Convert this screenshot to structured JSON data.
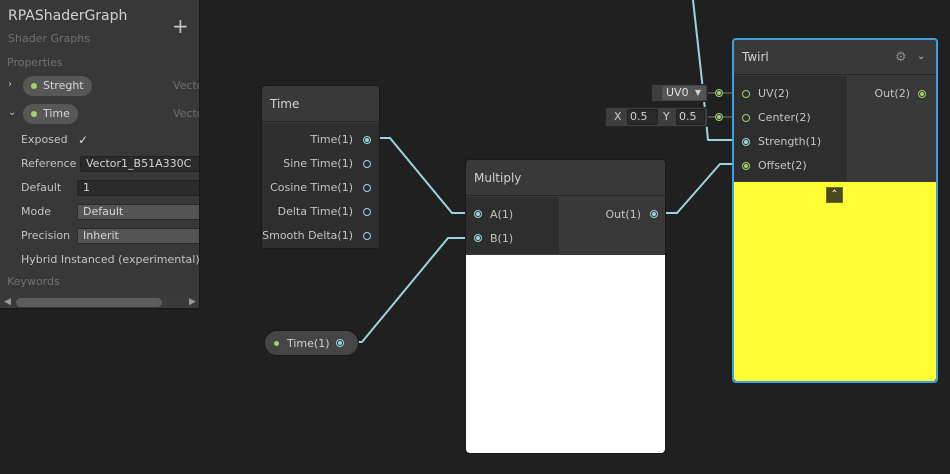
{
  "blackboard": {
    "title": "RPAShaderGraph",
    "subtitle": "Shader Graphs",
    "add_icon": "+",
    "properties_header": "Properties",
    "keywords_header": "Keywords",
    "properties": [
      {
        "name": "Streght",
        "type": "Vecto",
        "expanded": false
      },
      {
        "name": "Time",
        "type": "Vecto",
        "expanded": true
      }
    ],
    "fields": {
      "exposed_label": "Exposed",
      "exposed_check": "✓",
      "reference_label": "Reference",
      "reference_value": "Vector1_B51A330C",
      "default_label": "Default",
      "default_value": "1",
      "mode_label": "Mode",
      "mode_value": "Default",
      "precision_label": "Precision",
      "precision_value": "Inherit",
      "hybrid_label": "Hybrid Instanced (experimental)"
    }
  },
  "nodes": {
    "time": {
      "title": "Time",
      "outputs": [
        "Time(1)",
        "Sine Time(1)",
        "Cosine Time(1)",
        "Delta Time(1)",
        "Smooth Delta(1)"
      ]
    },
    "multiply": {
      "title": "Multiply",
      "inputs": [
        "A(1)",
        "B(1)"
      ],
      "outputs": [
        "Out(1)"
      ],
      "preview_color": "#ffffff"
    },
    "twirl": {
      "title": "Twirl",
      "inputs": [
        "UV(2)",
        "Center(2)",
        "Strength(1)",
        "Offset(2)"
      ],
      "outputs": [
        "Out(2)"
      ],
      "preview_color": "#ffff33",
      "selection_color": "#3f9fe0"
    },
    "time_property": {
      "label": "Time(1)"
    }
  },
  "inline_inputs": {
    "uv_channel": "UV0",
    "center_x_label": "X",
    "center_x": "0.5",
    "center_y_label": "Y",
    "center_y": "0.5"
  },
  "colors": {
    "wire": "#9ad4e0",
    "float_port": "#9ad4e0",
    "vector2_port": "#9ed26b"
  }
}
